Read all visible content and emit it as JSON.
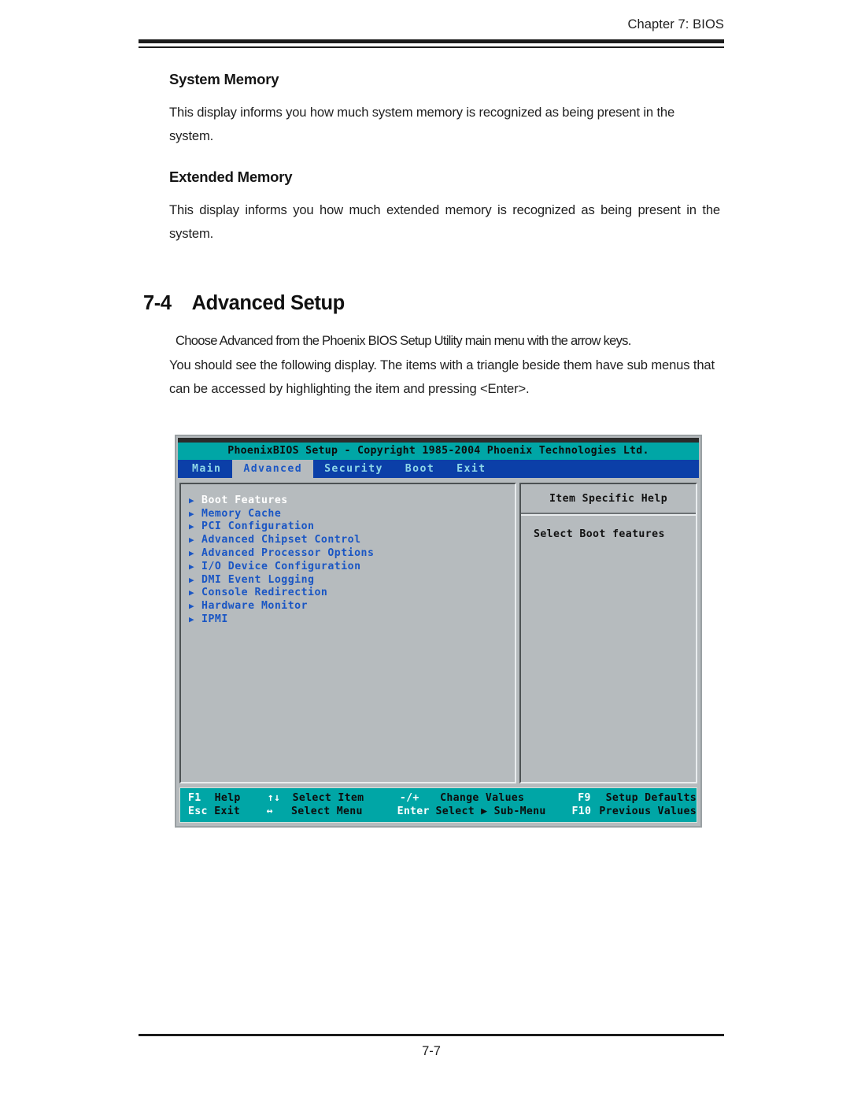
{
  "page": {
    "running_head": "Chapter 7: BIOS",
    "page_number": "7-7"
  },
  "sections": [
    {
      "heading": "System Memory",
      "paragraph": "This display informs you how much system memory is recognized as being present in the system."
    },
    {
      "heading": "Extended Memory",
      "paragraph": "This display informs you how much extended memory is recognized as being present in the system."
    }
  ],
  "numbered_section": {
    "number": "7-4",
    "title": "Advanced Setup",
    "paragraph_line1": "Choose Advanced from the Phoenix BIOS Setup Utility main menu with the arrow keys.",
    "paragraph_rest": "You should see the following display.  The items with a triangle beside them have sub menus that can be accessed by highlighting the item and pressing <Enter>."
  },
  "bios": {
    "title": "PhoenixBIOS Setup - Copyright 1985-2004 Phoenix Technologies Ltd.",
    "tabs": [
      {
        "label": "Main",
        "active": false
      },
      {
        "label": "Advanced",
        "active": true
      },
      {
        "label": "Security",
        "active": false
      },
      {
        "label": "Boot",
        "active": false
      },
      {
        "label": "Exit",
        "active": false
      }
    ],
    "menu_items": [
      {
        "label": "Boot Features",
        "selected": true
      },
      {
        "label": "Memory Cache",
        "selected": false
      },
      {
        "label": "PCI Configuration",
        "selected": false
      },
      {
        "label": "Advanced Chipset Control",
        "selected": false
      },
      {
        "label": "Advanced Processor Options",
        "selected": false
      },
      {
        "label": "I/O Device Configuration",
        "selected": false
      },
      {
        "label": "DMI Event Logging",
        "selected": false
      },
      {
        "label": "Console Redirection",
        "selected": false
      },
      {
        "label": "Hardware Monitor",
        "selected": false
      },
      {
        "label": "IPMI",
        "selected": false
      }
    ],
    "help": {
      "title": "Item Specific Help",
      "text": "Select Boot features"
    },
    "footer": {
      "row1": {
        "key1": "F1",
        "action1": "Help",
        "key2": "↑↓",
        "action2": "Select Item",
        "key3": "-/+",
        "action3": "Change Values",
        "key4": "F9",
        "action4": "Setup Defaults"
      },
      "row2": {
        "key1": "Esc",
        "action1": "Exit",
        "key2": "↔",
        "action2": "Select Menu",
        "key3": "Enter",
        "action3": "Select ▶ Sub-Menu",
        "key4": "F10",
        "action4": "Previous Values"
      }
    },
    "colors": {
      "titlebar": "#00a6a6",
      "menubar": "#0b3fa8",
      "panel": "#b6bbbe",
      "item_text": "#1a56c4",
      "selected_text": "#ffffff"
    }
  }
}
